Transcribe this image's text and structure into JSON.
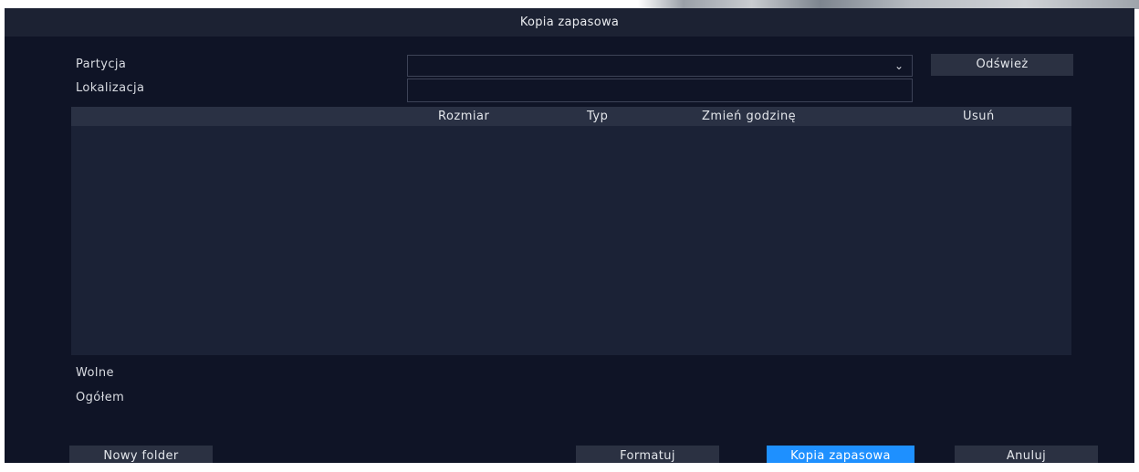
{
  "dialog": {
    "title": "Kopia zapasowa"
  },
  "form": {
    "partition_label": "Partycja",
    "partition_value": "",
    "location_label": "Lokalizacja",
    "location_value": "",
    "refresh_button": "Odśwież"
  },
  "table": {
    "columns": [
      "",
      "Rozmiar",
      "Typ",
      "Zmień godzinę",
      "Usuń"
    ],
    "rows": []
  },
  "storage": {
    "free_label": "Wolne",
    "total_label": "Ogółem"
  },
  "footer": {
    "new_folder_button": "Nowy folder",
    "format_button": "Formatuj",
    "backup_button": "Kopia zapasowa",
    "cancel_button": "Anuluj"
  },
  "colors": {
    "background": "#0f1426",
    "titlebar": "#1c2233",
    "table_body": "#1b2236",
    "table_header": "#2a3144",
    "button": "#2b3142",
    "primary_button": "#1e90ff"
  },
  "icons": {
    "partition_dropdown": "chevron-down-icon"
  }
}
